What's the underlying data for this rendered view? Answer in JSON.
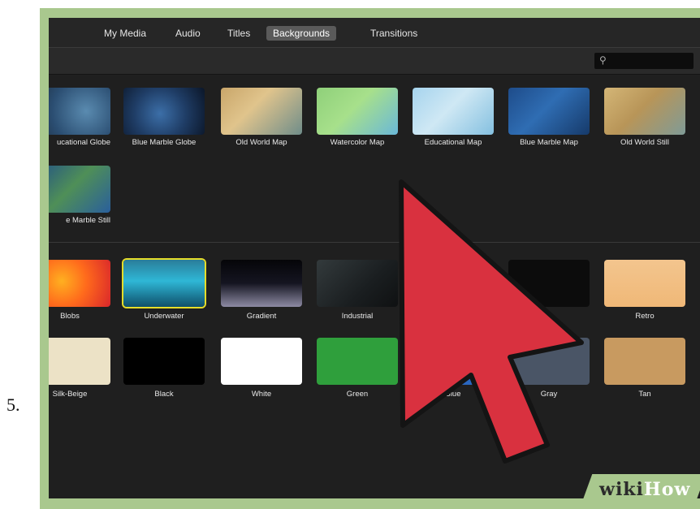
{
  "step_number": "5.",
  "tabs": [
    "My Media",
    "Audio",
    "Titles",
    "Backgrounds",
    "Transitions"
  ],
  "active_tab": "Backgrounds",
  "map_row1": [
    "ucational Globe",
    "Blue Marble Globe",
    "Old World Map",
    "Watercolor Map",
    "Educational Map",
    "Blue Marble Map",
    "Old World Still"
  ],
  "map_row2": [
    "e Marble Still"
  ],
  "solid_row1": [
    "Blobs",
    "Underwater",
    "Gradient",
    "Industrial",
    "",
    "",
    "Retro"
  ],
  "solid_row2": [
    "Silk-Beige",
    "Black",
    "White",
    "Green",
    "Blue",
    "Gray",
    "Tan"
  ],
  "watermark": {
    "wiki": "wiki",
    "how": "How"
  },
  "colors": {
    "frame": "#a9c88e",
    "selected": "#e5dd2a",
    "cursor": "#d9313f"
  }
}
